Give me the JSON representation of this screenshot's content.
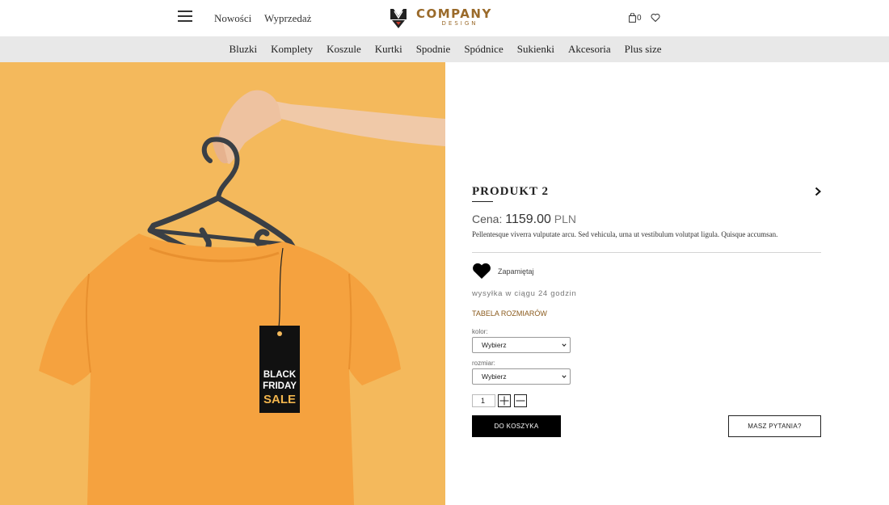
{
  "header": {
    "nav_links": [
      "Nowości",
      "Wyprzedaż"
    ],
    "logo": {
      "title": "COMPANY",
      "subtitle": "DESIGN"
    },
    "cart_count": "0"
  },
  "categories": [
    "Bluzki",
    "Komplety",
    "Koszule",
    "Kurtki",
    "Spodnie",
    "Spódnice",
    "Sukienki",
    "Akcesoria",
    "Plus size"
  ],
  "hero": {
    "tag_text": [
      "BLACK",
      "FRIDAY",
      "SALE"
    ],
    "colors": {
      "background": "#f4b95c",
      "shirt": "#f5a23f"
    }
  },
  "product": {
    "title": "PRODUKT 2",
    "price_label": "Cena:",
    "price_value": "1159.00",
    "currency": "PLN",
    "description": "Pellentesque viverra vulputate arcu. Sed vehicula, urna ut vestibulum volutpat ligula. Quisque accumsan.",
    "remember_label": "Zapamiętaj",
    "shipping": "wysyłka w ciągu 24 godzin",
    "size_table_link": "TABELA ROZMIARÓW",
    "color_label": "kolor:",
    "color_value": "Wybierz",
    "size_label": "rozmiar:",
    "size_value": "Wybierz",
    "quantity": "1",
    "add_to_cart": "DO KOSZYKA",
    "ask_question": "MASZ PYTANIA?"
  },
  "colors": {
    "accent": "#8a5a1c",
    "logo": "#9a6a2a",
    "category_bar": "#e8e8e8"
  }
}
